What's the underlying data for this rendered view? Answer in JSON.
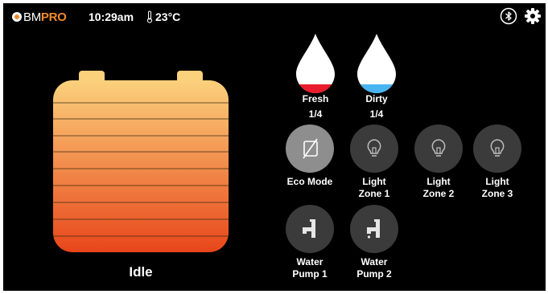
{
  "header": {
    "brand_bm": "BM",
    "brand_pro": "PRO",
    "time": "10:29am",
    "temperature": "23°C",
    "icons": [
      "logo-icon",
      "thermometer-icon",
      "bluetooth-icon",
      "gear-icon"
    ]
  },
  "battery": {
    "status": "Idle",
    "gradient_top": "#fbd17c",
    "gradient_bottom": "#e8461a"
  },
  "tanks": [
    {
      "name": "Fresh",
      "level": "1/4",
      "fraction": 0.25,
      "fill_color": "#e81c2c"
    },
    {
      "name": "Dirty",
      "level": "1/4",
      "fraction": 0.25,
      "fill_color": "#4ab4f0"
    }
  ],
  "controls": [
    {
      "label_line1": "Eco Mode",
      "label_line2": "",
      "icon": "eco-mode-icon",
      "active": true
    },
    {
      "label_line1": "Light",
      "label_line2": "Zone 1",
      "icon": "light-bulb-icon",
      "active": false
    },
    {
      "label_line1": "Light",
      "label_line2": "Zone 2",
      "icon": "light-bulb-icon",
      "active": false
    },
    {
      "label_line1": "Light",
      "label_line2": "Zone 3",
      "icon": "light-bulb-icon",
      "active": false
    },
    {
      "label_line1": "Water",
      "label_line2": "Pump 1",
      "icon": "water-tap-icon",
      "active": false
    },
    {
      "label_line1": "Water",
      "label_line2": "Pump 2",
      "icon": "water-tap-icon",
      "active": false
    }
  ]
}
